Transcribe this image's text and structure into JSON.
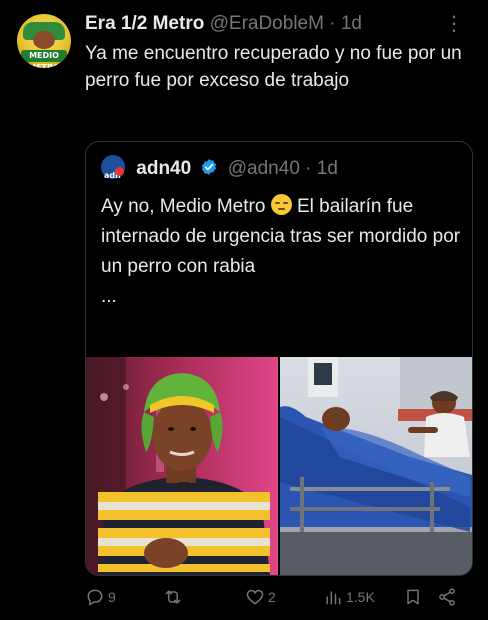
{
  "tweet": {
    "display_name": "Era 1/2 Metro",
    "handle": "@EraDobleM",
    "separator": "·",
    "age": "1d",
    "more_icon": "more-vertical-icon",
    "text": "Ya me encuentro recuperado y no fue por un perro fue por exceso de trabajo",
    "avatar_text": "MEDIO METRO"
  },
  "quote": {
    "display_name": "adn40",
    "logo_text": "adn",
    "handle": "@adn40",
    "separator": "·",
    "age": "1d",
    "text_before_emoji": "Ay no, Medio Metro",
    "text_after_emoji": " El bailarín fue internado de urgencia tras ser mordido por un perro con rabia",
    "ellipsis": "...",
    "images": [
      {
        "label": "man in green hat and striped shirt"
      },
      {
        "label": "patient in hospital bed"
      }
    ]
  },
  "actions": {
    "reply_count": "9",
    "retweet_count": "",
    "like_count": "2",
    "views_count": "1.5K"
  },
  "colors": {
    "background": "#000000",
    "text": "#e7e9ea",
    "muted": "#71767b",
    "border": "#2f3336",
    "verified": "#1d9bf0"
  }
}
